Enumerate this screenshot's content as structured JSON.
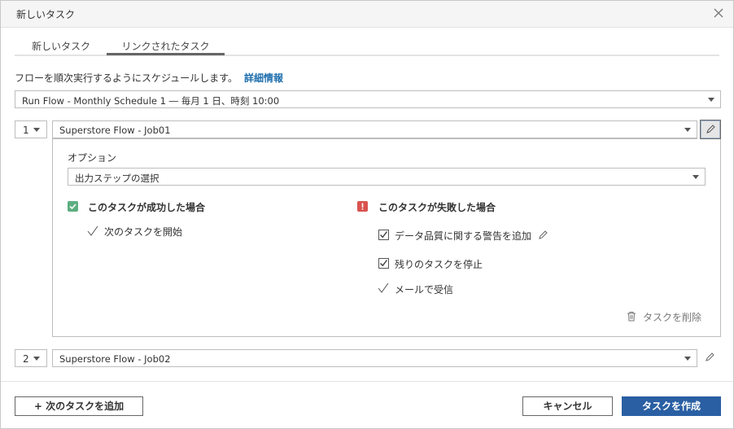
{
  "dialog": {
    "title": "新しいタスク",
    "close_icon": "close-icon"
  },
  "tabs": [
    {
      "label": "新しいタスク",
      "active": false
    },
    {
      "label": "リンクされたタスク",
      "active": true
    }
  ],
  "description": {
    "text": "フローを順次実行するようにスケジュールします。",
    "link": "詳細情報"
  },
  "schedule_select": {
    "value": "Run Flow - Monthly Schedule 1 ― 毎月 1 日、時刻 10:00"
  },
  "tasks": [
    {
      "number": "1",
      "flow": "Superstore Flow - Job01",
      "options_label": "オプション",
      "output_step_select": "出力ステップの選択",
      "success": {
        "heading": "このタスクが成功した場合",
        "items": [
          {
            "label": "次のタスクを開始",
            "type": "check"
          }
        ]
      },
      "failure": {
        "heading": "このタスクが失敗した場合",
        "items": [
          {
            "label": "データ品質に関する警告を追加",
            "type": "checkbox",
            "checked": true
          },
          {
            "label": "残りのタスクを停止",
            "type": "checkbox",
            "checked": true
          },
          {
            "label": "メールで受信",
            "type": "check"
          }
        ]
      },
      "delete_label": "タスクを削除"
    },
    {
      "number": "2",
      "flow": "Superstore Flow - Job02"
    }
  ],
  "footer": {
    "add_task_label": "+ 次のタスクを追加",
    "cancel_label": "キャンセル",
    "create_label": "タスクを作成"
  },
  "colors": {
    "primary": "#2a5fa3",
    "link": "#1f6fae",
    "success": "#5dae81",
    "error": "#d9534f"
  }
}
